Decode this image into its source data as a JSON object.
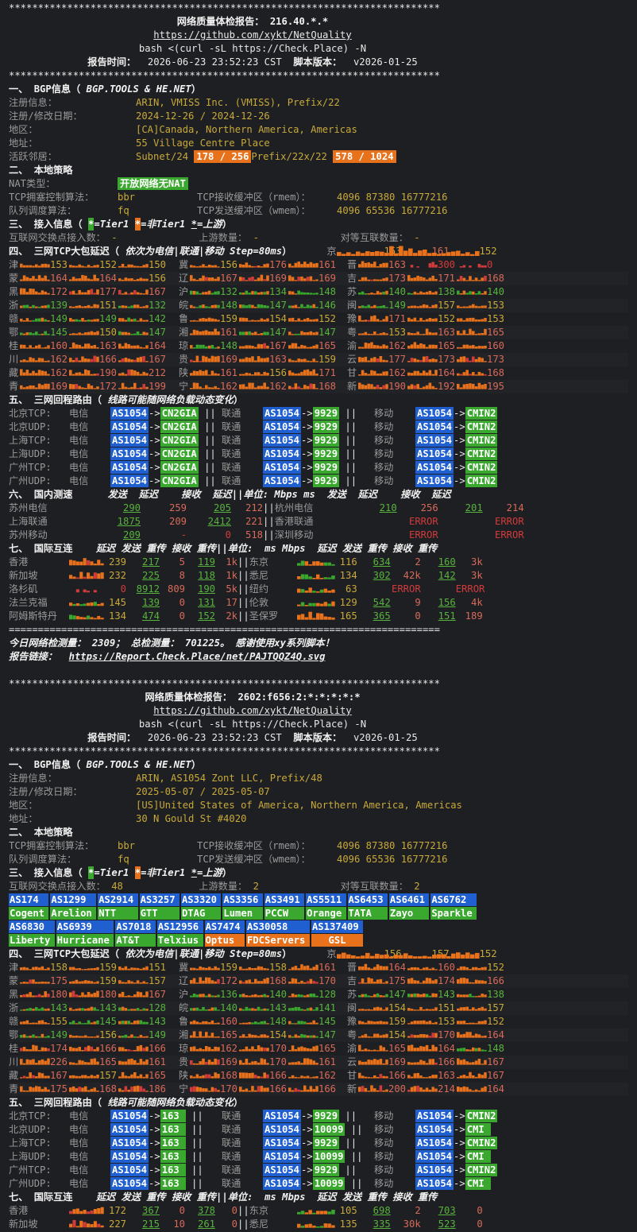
{
  "report1": {
    "sep": "**************************************************************************",
    "title": "网络质量体检报告： 216.40.*.*",
    "github": "https://github.com/xykt/NetQuality",
    "cmd": "bash <(curl -sL https://Check.Place) -N",
    "time_label": "报告时间：",
    "time": "2026-06-23 23:52:23 CST",
    "ver_label": "脚本版本：",
    "ver": "v2026-01-25",
    "s1_head": "一、 BGP信息（",
    "s1_src": "BGP.TOOLS & HE.NET",
    "s1_tail": "）",
    "reg_label": "注册信息：",
    "reg": "ARIN, VMISS Inc. (VMISS), Prefix/22",
    "date_label": "注册/修改日期：",
    "date": "2024-12-26 / 2024-12-26",
    "region_label": "地区：",
    "region": "[CA]Canada, Northern America, Americas",
    "addr_label": "地址：",
    "addr": "55 Village Centre Place",
    "nb_label": "活跃邻居：",
    "nb_sub": "Subnet/24",
    "nb_sub_val": "178 / 256",
    "nb_pre": "Prefix/22",
    "nb_pre_val": "578 / 1024",
    "s2_head": "二、 本地策略",
    "nat_label": "NAT类型：",
    "nat": "开放网络无NAT",
    "tcp_label": "TCP拥塞控制算法：",
    "tcp": "bbr",
    "rmem_label": "TCP接收缓冲区（rmem）：",
    "rmem": "4096 87380 16777216",
    "q_label": "队列调度算法：",
    "q": "fq",
    "wmem_label": "TCP发送缓冲区（wmem）：",
    "wmem": "4096 65536 16777216",
    "s3_head": "三、 接入信息（",
    "s3_t1": "=Tier1",
    "s3_nt1": "=非Tier1",
    "s3_up": "=上游",
    "s3_tail": "）",
    "ix_label": "互联网交换点接入数：",
    "ix": "-",
    "up_label": "上游数量：",
    "up": "-",
    "peer_label": "对等互联数量：",
    "peer": "-",
    "s4_head": "四、 三网TCP大包延迟（",
    "s4_desc": "依次为电信|联通|移动 Step=80ms",
    "s4_tail": "）",
    "s4_rows": [
      [
        "京",
        "153",
        "161",
        "152"
      ],
      [
        "津",
        "153",
        "152",
        "150"
      ],
      [
        "冀",
        "156",
        "176",
        "161"
      ],
      [
        "晋",
        "163",
        "300",
        "0"
      ],
      [
        "蒙",
        "164",
        "164",
        "156"
      ],
      [
        "辽",
        "167",
        "169",
        "169"
      ],
      [
        "吉",
        "173",
        "171",
        "168"
      ],
      [
        "黑",
        "172",
        "177",
        "167"
      ],
      [
        "沪",
        "132",
        "134",
        "148"
      ],
      [
        "苏",
        "140",
        "138",
        "140"
      ],
      [
        "浙",
        "139",
        "151",
        "132"
      ],
      [
        "皖",
        "148",
        "147",
        "146"
      ],
      [
        "闽",
        "149",
        "157",
        "153"
      ],
      [
        "赣",
        "149",
        "149",
        "142"
      ],
      [
        "鲁",
        "159",
        "154",
        "152"
      ],
      [
        "豫",
        "171",
        "152",
        "153"
      ],
      [
        "鄂",
        "145",
        "150",
        "147"
      ],
      [
        "湘",
        "161",
        "147",
        "147"
      ],
      [
        "粤",
        "153",
        "163",
        "165"
      ],
      [
        "桂",
        "160",
        "163",
        "164"
      ],
      [
        "琼",
        "148",
        "167",
        "165"
      ],
      [
        "渝",
        "162",
        "165",
        "160"
      ],
      [
        "川",
        "162",
        "166",
        "167"
      ],
      [
        "贵",
        "169",
        "163",
        "159"
      ],
      [
        "云",
        "177",
        "173",
        "173"
      ],
      [
        "藏",
        "162",
        "190",
        "212"
      ],
      [
        "陕",
        "161",
        "156",
        "171"
      ],
      [
        "甘",
        "162",
        "164",
        "168"
      ],
      [
        "青",
        "169",
        "172",
        "199"
      ],
      [
        "宁",
        "162",
        "162",
        "168"
      ],
      [
        "新",
        "190",
        "192",
        "195"
      ]
    ],
    "s5_head": "五、 三网回程路由（",
    "s5_desc": "线路可能随网络负载动态变化",
    "s5_tail": "）",
    "routes": [
      [
        "北京TCP:",
        "CN2GIA",
        "9929",
        "CMIN2"
      ],
      [
        "北京UDP:",
        "CN2GIA",
        "9929",
        "CMIN2"
      ],
      [
        "上海TCP:",
        "CN2GIA",
        "9929",
        "CMIN2"
      ],
      [
        "上海UDP:",
        "CN2GIA",
        "9929",
        "CMIN2"
      ],
      [
        "广州TCP:",
        "CN2GIA",
        "9929",
        "CMIN2"
      ],
      [
        "广州UDP:",
        "CN2GIA",
        "9929",
        "CMIN2"
      ]
    ],
    "isp": {
      "ct": "电信",
      "cu": "联通",
      "cm": "移动",
      "as": "AS1054",
      "arrow": "->"
    },
    "s6_head": "六、 国内测速",
    "s6_cols": "发送  延迟    接收  延迟||单位: Mbps ms  发送  延迟    接收  延迟",
    "s6_rows": [
      [
        "苏州电信",
        "290",
        "259",
        "205",
        "212",
        "杭州电信",
        "210",
        "256",
        "201",
        "214"
      ],
      [
        "上海联通",
        "1875",
        "209",
        "2412",
        "221",
        "香港联通",
        "",
        "ERROR",
        "",
        "ERROR"
      ],
      [
        "苏州移动",
        "209",
        "-",
        "0",
        "518",
        "深圳移动",
        "",
        "ERROR",
        "",
        "ERROR"
      ]
    ],
    "s7_head": "七、 国际互连",
    "s7_cols": "延迟 发送 重传 接收 重传||单位:  ms Mbps  延迟 发送 重传 接收 重传",
    "s7_rows": [
      [
        "香港",
        "239",
        "217",
        "5",
        "119",
        "1k",
        "东京",
        "116",
        "634",
        "2",
        "160",
        "3k"
      ],
      [
        "新加坡",
        "232",
        "225",
        "8",
        "118",
        "1k",
        "悉尼",
        "134",
        "302",
        "42k",
        "142",
        "3k"
      ],
      [
        "洛杉矶",
        "0",
        "8912",
        "809",
        "190",
        "5k",
        "纽约",
        "63",
        "",
        "ERROR",
        "",
        "ERROR"
      ],
      [
        "法兰克福",
        "145",
        "139",
        "0",
        "131",
        "17",
        "伦敦",
        "129",
        "542",
        "9",
        "156",
        "4k"
      ],
      [
        "阿姆斯特丹",
        "134",
        "474",
        "0",
        "152",
        "2k",
        "圣保罗",
        "165",
        "365",
        "0",
        "151",
        "189"
      ]
    ],
    "eq": "==========================================================================",
    "foot1": "今日网络检测量： 2309； 总检测量： 701225。 感谢使用xy系列脚本！",
    "foot2_label": "报告链接：",
    "foot2": "https://Report.Check.Place/net/PAJTQQZ4Q.svg"
  },
  "report2": {
    "title": "网络质量体检报告： 2602:f656:2:*:*:*:*:*",
    "reg": "ARIN, AS1054 Zont LLC, Prefix/48",
    "date": "2025-05-07 / 2025-05-07",
    "region": "[US]United States of America, Northern America, Americas",
    "addr": "30 N Gould St #4020",
    "ix": "48",
    "up": "2",
    "peer": "2",
    "asns": [
      [
        "AS174",
        "Cogent",
        "b"
      ],
      [
        "AS1299",
        "Arelion",
        "b"
      ],
      [
        "AS2914",
        "NTT",
        "b"
      ],
      [
        "AS3257",
        "GTT",
        "b"
      ],
      [
        "AS3320",
        "DTAG",
        "b"
      ],
      [
        "AS3356",
        "Lumen",
        "b"
      ],
      [
        "AS3491",
        "PCCW",
        "b"
      ],
      [
        "AS5511",
        "Orange",
        "b"
      ],
      [
        "AS6453",
        "TATA",
        "b"
      ],
      [
        "AS6461",
        "Zayo",
        "b"
      ],
      [
        "AS6762",
        "Sparkle",
        "b"
      ]
    ],
    "asns2": [
      [
        "AS6830",
        "Liberty",
        "b"
      ],
      [
        "AS6939",
        "Hurricane",
        "b"
      ],
      [
        "AS7018",
        "AT&T",
        "b"
      ],
      [
        "AS12956",
        "Telxius",
        "b"
      ],
      [
        "AS7474",
        "Optus",
        "o"
      ],
      [
        "AS30058",
        "FDCServers",
        "o"
      ],
      [
        "AS137409",
        "GSL",
        "o"
      ]
    ],
    "s4_rows": [
      [
        "京",
        "156",
        "157",
        "152"
      ],
      [
        "津",
        "158",
        "159",
        "151"
      ],
      [
        "冀",
        "159",
        "158",
        "161"
      ],
      [
        "晋",
        "164",
        "160",
        "152"
      ],
      [
        "蒙",
        "175",
        "159",
        "157"
      ],
      [
        "辽",
        "172",
        "168",
        "170"
      ],
      [
        "吉",
        "175",
        "174",
        "166"
      ],
      [
        "黑",
        "180",
        "180",
        "167"
      ],
      [
        "沪",
        "136",
        "140",
        "128"
      ],
      [
        "苏",
        "147",
        "143",
        "138"
      ],
      [
        "浙",
        "143",
        "143",
        "128"
      ],
      [
        "皖",
        "140",
        "143",
        "141"
      ],
      [
        "闽",
        "154",
        "151",
        "157"
      ],
      [
        "赣",
        "155",
        "145",
        "143"
      ],
      [
        "鲁",
        "160",
        "148",
        "145"
      ],
      [
        "豫",
        "159",
        "153",
        "152"
      ],
      [
        "鄂",
        "149",
        "156",
        "149"
      ],
      [
        "湘",
        "165",
        "154",
        "147"
      ],
      [
        "粤",
        "154",
        "170",
        "164"
      ],
      [
        "桂",
        "174",
        "166",
        "166"
      ],
      [
        "琼",
        "162",
        "170",
        "165"
      ],
      [
        "渝",
        "165",
        "164",
        "148"
      ],
      [
        "川",
        "226",
        "165",
        "161"
      ],
      [
        "贵",
        "169",
        "170",
        "161"
      ],
      [
        "云",
        "169",
        "166",
        "167"
      ],
      [
        "藏",
        "167",
        "157",
        "165"
      ],
      [
        "陕",
        "168",
        "166",
        "162"
      ],
      [
        "甘",
        "166",
        "163",
        "167"
      ],
      [
        "青",
        "175",
        "168",
        "186"
      ],
      [
        "宁",
        "170",
        "166",
        "166"
      ],
      [
        "新",
        "200",
        "214",
        "164"
      ]
    ],
    "routes": [
      [
        "北京TCP:",
        "163",
        "9929",
        "CMIN2"
      ],
      [
        "北京UDP:",
        "163",
        "10099",
        "CMI"
      ],
      [
        "上海TCP:",
        "163",
        "9929",
        "CMIN2"
      ],
      [
        "上海UDP:",
        "163",
        "10099",
        "CMI"
      ],
      [
        "广州TCP:",
        "163",
        "9929",
        "CMIN2"
      ],
      [
        "广州UDP:",
        "163",
        "10099",
        "CMI"
      ]
    ],
    "s7_rows": [
      [
        "香港",
        "172",
        "367",
        "0",
        "378",
        "0",
        "东京",
        "105",
        "698",
        "2",
        "703",
        "0"
      ],
      [
        "新加坡",
        "227",
        "215",
        "10",
        "261",
        "0",
        "悉尼",
        "135",
        "335",
        "30k",
        "523",
        "0"
      ]
    ]
  },
  "colors": {
    "bg": "#1e1f22",
    "orange": "#e8711b",
    "green": "#3aa82e",
    "blue": "#1f5fd0",
    "red": "#d23b3b"
  }
}
